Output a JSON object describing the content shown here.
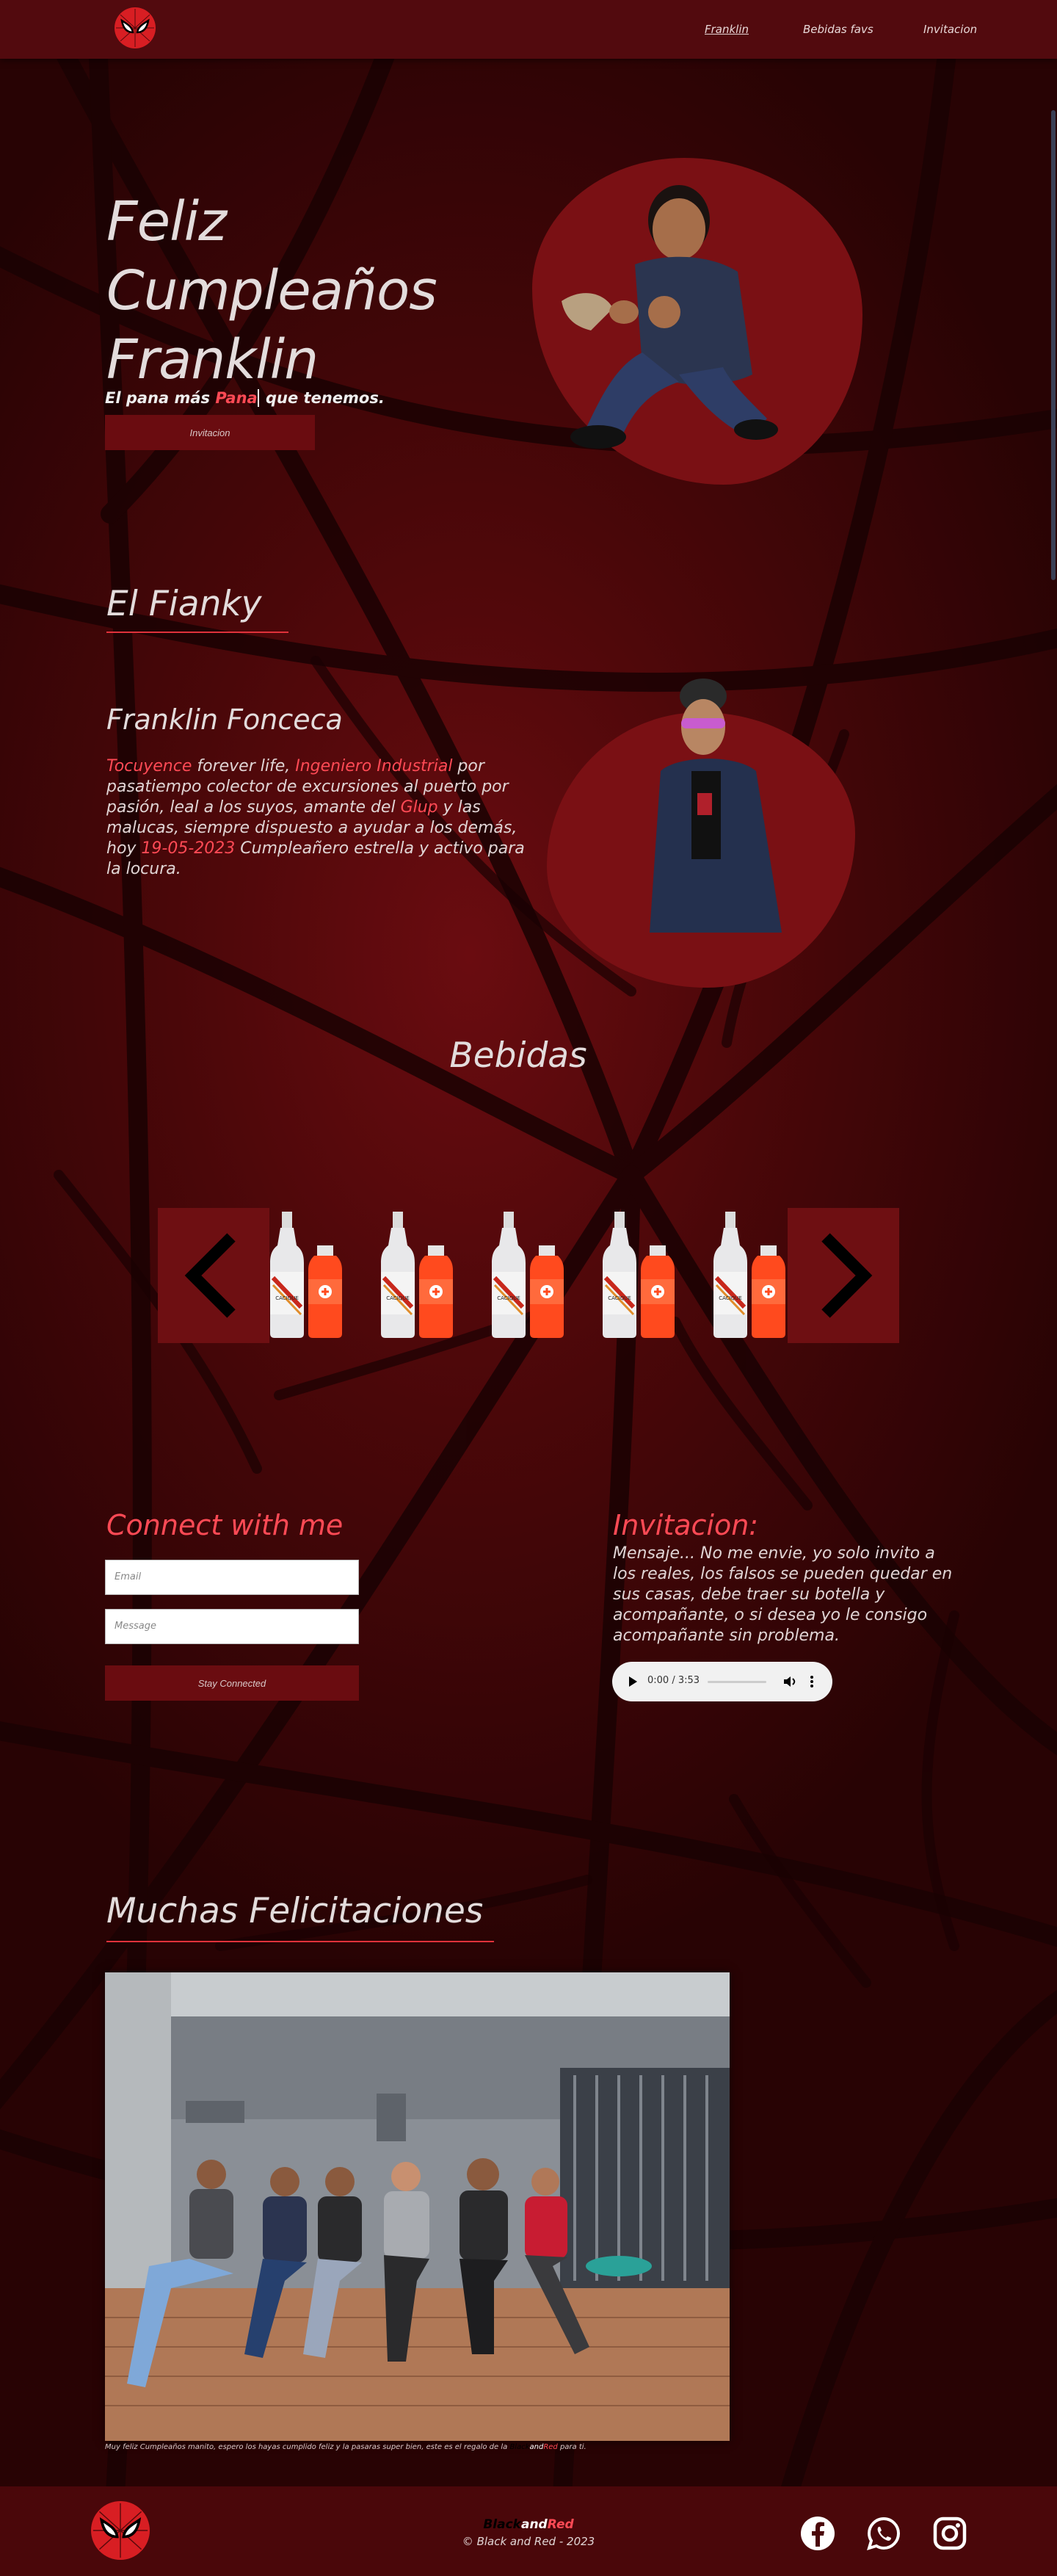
{
  "nav": {
    "links": [
      "Franklin",
      "Bebidas favs",
      "Invitacion"
    ]
  },
  "hero": {
    "title_lines": [
      "Feliz",
      "Cumpleaños",
      "Franklin"
    ],
    "subtitle_pre": "El pana más ",
    "subtitle_highlight": "Pana",
    "subtitle_post": " que tenemos.",
    "button": "Invitacion"
  },
  "about": {
    "heading": "El Fianky",
    "name": "Franklin Fonceca",
    "bio": [
      {
        "t": "Tocuyence",
        "hl": true
      },
      {
        "t": " forever life, ",
        "hl": false
      },
      {
        "t": "Ingeniero Industrial",
        "hl": true
      },
      {
        "t": " por pasatiempo colector de excursiones al puerto por pasión, leal a los suyos, amante del ",
        "hl": false
      },
      {
        "t": "Glup",
        "hl": true
      },
      {
        "t": " y las malucas, siempre dispuesto a ayudar a los demás, hoy ",
        "hl": false
      },
      {
        "t": "19-05-2023",
        "hl": true
      },
      {
        "t": " Cumpleañero estrella y activo para la locura.",
        "hl": false
      }
    ]
  },
  "drinks": {
    "heading": "Bebidas",
    "prev": "previous",
    "next": "next",
    "bottle_label": "CACIQUE",
    "count": 5
  },
  "connect": {
    "heading": "Connect with me",
    "email_placeholder": "Email",
    "message_placeholder": "Message",
    "button": "Stay Connected"
  },
  "invite": {
    "heading": "Invitacion:",
    "text": "Mensaje... No me envie, yo solo invito a los reales, los falsos se pueden quedar en sus casas, debe traer su botella y acompañante, o si desea yo le consigo acompañante sin problema.",
    "audio_time": "0:00 / 3:53",
    "audio_progress": 0
  },
  "congrats": {
    "heading": "Muchas Felicitaciones",
    "caption_pre": "Muy feliz Cumpleaños manito, espero los hayas cumplido feliz y la pasaras super bien, este es el regalo de la ",
    "caption_black": "Black",
    "caption_and": "and",
    "caption_red": "Red",
    "caption_post": " para ti."
  },
  "footer": {
    "brand_black": "Black",
    "brand_and": "and",
    "brand_red": "Red",
    "copyright": "© Black and Red - 2023"
  },
  "social": [
    "facebook-icon",
    "whatsapp-icon",
    "instagram-icon"
  ],
  "colors": {
    "accent": "#ff4a55",
    "header": "#520a0e",
    "button": "#6a0c10",
    "blob": "#7a1014"
  }
}
